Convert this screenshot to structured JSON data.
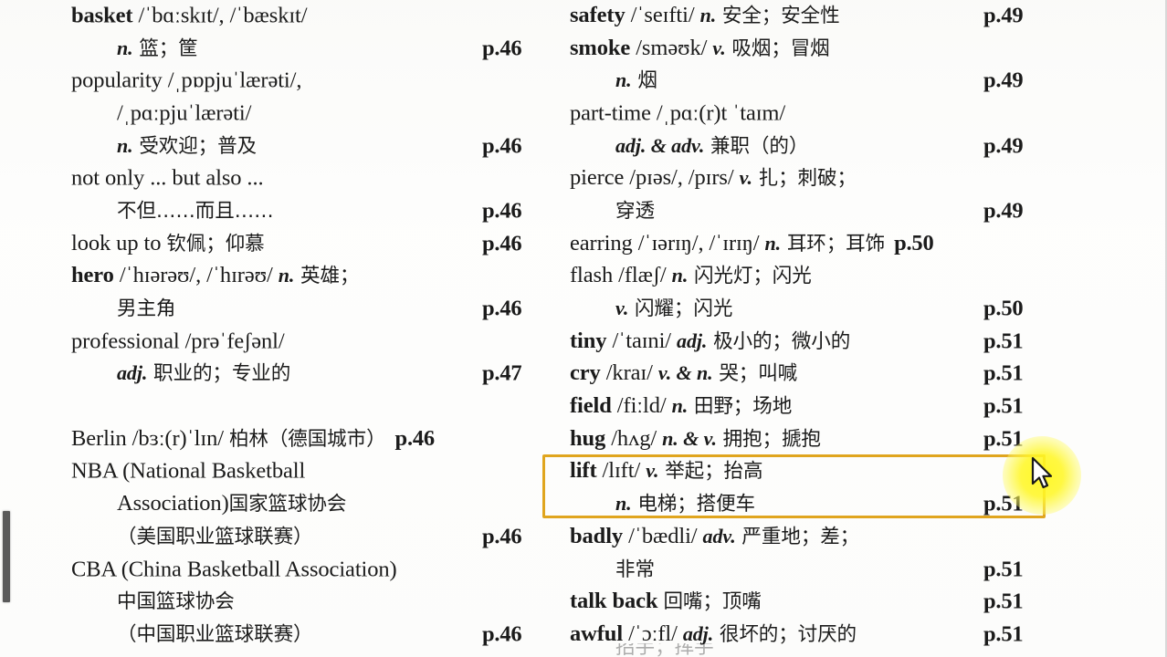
{
  "document": {
    "type": "scanned-vocabulary-list",
    "page_background": "#fefefe",
    "text_color": "#1b1b1b"
  },
  "highlight": {
    "border_color": "#e0a51e",
    "target_entry": "lift",
    "label": "highlighted-entry-lift"
  },
  "cursor": {
    "glow_color": "#fff71e",
    "type": "arrow-pointer"
  },
  "left_column": {
    "entries": [
      {
        "lines": [
          {
            "indent": false,
            "segments": [
              {
                "style": "hw",
                "text": "basket"
              },
              {
                "style": "ipa",
                "text": " /ˈbɑːskɪt/, /ˈbæskɪt/"
              }
            ],
            "page": ""
          },
          {
            "indent": true,
            "segments": [
              {
                "style": "pos",
                "text": "n."
              },
              {
                "style": "cn",
                "text": " 篮；筐"
              }
            ],
            "page": "p.46"
          }
        ]
      },
      {
        "lines": [
          {
            "indent": false,
            "segments": [
              {
                "style": "plain",
                "text": "popularity"
              },
              {
                "style": "ipa",
                "text": " /ˌpɒpjuˈlærəti/,"
              }
            ],
            "page": ""
          },
          {
            "indent": true,
            "segments": [
              {
                "style": "ipa",
                "text": "/ˌpɑːpjuˈlærəti/"
              }
            ],
            "page": ""
          },
          {
            "indent": true,
            "segments": [
              {
                "style": "pos",
                "text": "n."
              },
              {
                "style": "cn",
                "text": " 受欢迎；普及"
              }
            ],
            "page": "p.46"
          }
        ]
      },
      {
        "lines": [
          {
            "indent": false,
            "segments": [
              {
                "style": "plain",
                "text": "not only ... but also ..."
              }
            ],
            "page": ""
          },
          {
            "indent": true,
            "segments": [
              {
                "style": "cn",
                "text": "不但……而且……"
              }
            ],
            "page": "p.46"
          }
        ]
      },
      {
        "lines": [
          {
            "indent": false,
            "segments": [
              {
                "style": "plain",
                "text": "look up to "
              },
              {
                "style": "cn",
                "text": "钦佩；仰慕"
              }
            ],
            "page": "p.46"
          }
        ]
      },
      {
        "lines": [
          {
            "indent": false,
            "segments": [
              {
                "style": "hw",
                "text": "hero"
              },
              {
                "style": "ipa",
                "text": " /ˈhɪərəʊ/, /ˈhɪrəʊ/ "
              },
              {
                "style": "pos",
                "text": "n."
              },
              {
                "style": "cn",
                "text": " 英雄；"
              }
            ],
            "page": ""
          },
          {
            "indent": true,
            "segments": [
              {
                "style": "cn",
                "text": "男主角"
              }
            ],
            "page": "p.46"
          }
        ]
      },
      {
        "lines": [
          {
            "indent": false,
            "segments": [
              {
                "style": "plain",
                "text": "professional"
              },
              {
                "style": "ipa",
                "text": " /prəˈfeʃənl/"
              }
            ],
            "page": ""
          },
          {
            "indent": true,
            "segments": [
              {
                "style": "pos",
                "text": "adj."
              },
              {
                "style": "cn",
                "text": " 职业的；专业的"
              }
            ],
            "page": "p.47"
          }
        ]
      },
      {
        "spacer": true
      },
      {
        "lines": [
          {
            "indent": false,
            "segments": [
              {
                "style": "plain",
                "text": "Berlin"
              },
              {
                "style": "ipa",
                "text": " /bɜː(r)ˈlɪn/ "
              },
              {
                "style": "cn",
                "text": " 柏林（德国城市）"
              },
              {
                "style": "inline-page",
                "text": "p.46"
              }
            ],
            "page": ""
          }
        ]
      },
      {
        "lines": [
          {
            "indent": false,
            "segments": [
              {
                "style": "plain",
                "text": "NBA (National Basketball"
              }
            ],
            "page": ""
          },
          {
            "indent": true,
            "segments": [
              {
                "style": "plain",
                "text": "Association)"
              },
              {
                "style": "cn",
                "text": "国家篮球协会"
              }
            ],
            "page": ""
          },
          {
            "indent": true,
            "segments": [
              {
                "style": "cn",
                "text": "（美国职业篮球联赛）"
              }
            ],
            "page": "p.46"
          }
        ]
      },
      {
        "lines": [
          {
            "indent": false,
            "segments": [
              {
                "style": "plain",
                "text": "CBA (China Basketball Association)"
              }
            ],
            "page": ""
          },
          {
            "indent": true,
            "segments": [
              {
                "style": "cn",
                "text": "中国篮球协会"
              }
            ],
            "page": ""
          },
          {
            "indent": true,
            "segments": [
              {
                "style": "cn",
                "text": "（中国职业篮球联赛）"
              }
            ],
            "page": "p.46"
          }
        ]
      }
    ]
  },
  "right_column": {
    "entries": [
      {
        "lines": [
          {
            "indent": false,
            "segments": [
              {
                "style": "hw",
                "text": "safety"
              },
              {
                "style": "ipa",
                "text": " /ˈseɪfti/ "
              },
              {
                "style": "pos",
                "text": "n."
              },
              {
                "style": "cn",
                "text": " 安全；安全性"
              }
            ],
            "page": "p.49"
          }
        ]
      },
      {
        "lines": [
          {
            "indent": false,
            "segments": [
              {
                "style": "hw",
                "text": "smoke"
              },
              {
                "style": "ipa",
                "text": "  /sməʊk/ "
              },
              {
                "style": "pos",
                "text": "v."
              },
              {
                "style": "cn",
                "text": " 吸烟；冒烟"
              }
            ],
            "page": ""
          },
          {
            "indent": true,
            "segments": [
              {
                "style": "pos",
                "text": "n."
              },
              {
                "style": "cn",
                "text": " 烟"
              }
            ],
            "page": "p.49"
          }
        ]
      },
      {
        "lines": [
          {
            "indent": false,
            "segments": [
              {
                "style": "plain",
                "text": "part-time"
              },
              {
                "style": "ipa",
                "text": " /ˌpɑː(r)t ˈtaɪm/"
              }
            ],
            "page": ""
          },
          {
            "indent": true,
            "segments": [
              {
                "style": "pos",
                "text": "adj. & adv."
              },
              {
                "style": "cn",
                "text": " 兼职（的）"
              }
            ],
            "page": "p.49"
          }
        ]
      },
      {
        "lines": [
          {
            "indent": false,
            "segments": [
              {
                "style": "plain",
                "text": "pierce"
              },
              {
                "style": "ipa",
                "text": " /pɪəs/, /pɪrs/ "
              },
              {
                "style": "pos",
                "text": "v."
              },
              {
                "style": "cn",
                "text": " 扎；刺破；"
              }
            ],
            "page": ""
          },
          {
            "indent": true,
            "segments": [
              {
                "style": "cn",
                "text": "穿透"
              }
            ],
            "page": "p.49"
          }
        ]
      },
      {
        "lines": [
          {
            "indent": false,
            "segments": [
              {
                "style": "plain",
                "text": "earring"
              },
              {
                "style": "ipa",
                "text": " /ˈɪərɪŋ/, /ˈɪrɪŋ/ "
              },
              {
                "style": "pos",
                "text": "n."
              },
              {
                "style": "cn",
                "text": " 耳环；耳饰"
              },
              {
                "style": "inline-page",
                "text": "p.50"
              }
            ],
            "page": ""
          }
        ]
      },
      {
        "lines": [
          {
            "indent": false,
            "segments": [
              {
                "style": "plain",
                "text": "flash"
              },
              {
                "style": "ipa",
                "text": " /flæʃ/ "
              },
              {
                "style": "pos",
                "text": "n."
              },
              {
                "style": "cn",
                "text": " 闪光灯；闪光"
              }
            ],
            "page": ""
          },
          {
            "indent": true,
            "segments": [
              {
                "style": "pos",
                "text": "v."
              },
              {
                "style": "cn",
                "text": " 闪耀；闪光"
              }
            ],
            "page": "p.50"
          }
        ]
      },
      {
        "lines": [
          {
            "indent": false,
            "segments": [
              {
                "style": "hw",
                "text": "tiny"
              },
              {
                "style": "ipa",
                "text": " /ˈtaɪni/ "
              },
              {
                "style": "pos",
                "text": "adj."
              },
              {
                "style": "cn",
                "text": " 极小的；微小的"
              }
            ],
            "page": "p.51"
          }
        ]
      },
      {
        "lines": [
          {
            "indent": false,
            "segments": [
              {
                "style": "hw",
                "text": "cry"
              },
              {
                "style": "ipa",
                "text": " /kraɪ/ "
              },
              {
                "style": "pos",
                "text": "v. & n."
              },
              {
                "style": "cn",
                "text": " 哭；叫喊"
              }
            ],
            "page": "p.51"
          }
        ]
      },
      {
        "lines": [
          {
            "indent": false,
            "segments": [
              {
                "style": "hw",
                "text": "field"
              },
              {
                "style": "ipa",
                "text": " /fiːld/ "
              },
              {
                "style": "pos",
                "text": "n."
              },
              {
                "style": "cn",
                "text": " 田野；场地"
              }
            ],
            "page": "p.51"
          }
        ]
      },
      {
        "lines": [
          {
            "indent": false,
            "segments": [
              {
                "style": "hw",
                "text": "hug"
              },
              {
                "style": "ipa",
                "text": " /hʌg/ "
              },
              {
                "style": "pos",
                "text": "n. & v."
              },
              {
                "style": "cn",
                "text": " 拥抱；搋抱"
              }
            ],
            "page": "p.51"
          }
        ]
      },
      {
        "highlighted": true,
        "lines": [
          {
            "indent": false,
            "segments": [
              {
                "style": "hw",
                "text": "lift"
              },
              {
                "style": "ipa",
                "text": " /lɪft/ "
              },
              {
                "style": "pos",
                "text": "v."
              },
              {
                "style": "cn",
                "text": " 举起；抬高"
              }
            ],
            "page": ""
          },
          {
            "indent": true,
            "segments": [
              {
                "style": "pos",
                "text": "n."
              },
              {
                "style": "cn",
                "text": " 电梯；搭便车"
              }
            ],
            "page": "p.51"
          }
        ]
      },
      {
        "lines": [
          {
            "indent": false,
            "segments": [
              {
                "style": "hw",
                "text": "badly"
              },
              {
                "style": "ipa",
                "text": " /ˈbædli/ "
              },
              {
                "style": "pos",
                "text": "adv."
              },
              {
                "style": "cn",
                "text": " 严重地；差；"
              }
            ],
            "page": ""
          },
          {
            "indent": true,
            "segments": [
              {
                "style": "cn",
                "text": "非常"
              }
            ],
            "page": "p.51"
          }
        ]
      },
      {
        "lines": [
          {
            "indent": false,
            "segments": [
              {
                "style": "hw",
                "text": "talk back "
              },
              {
                "style": "cn",
                "text": "回嘴；顶嘴"
              }
            ],
            "page": "p.51"
          }
        ]
      },
      {
        "lines": [
          {
            "indent": false,
            "segments": [
              {
                "style": "hw",
                "text": "awful"
              },
              {
                "style": "ipa",
                "text": " /ˈɔːfl/ "
              },
              {
                "style": "pos",
                "text": "adj."
              },
              {
                "style": "cn",
                "text": " 很坏的；讨厌的"
              }
            ],
            "page": "p.51"
          }
        ]
      }
    ],
    "bottom_partial_line": "招手；挥手"
  }
}
